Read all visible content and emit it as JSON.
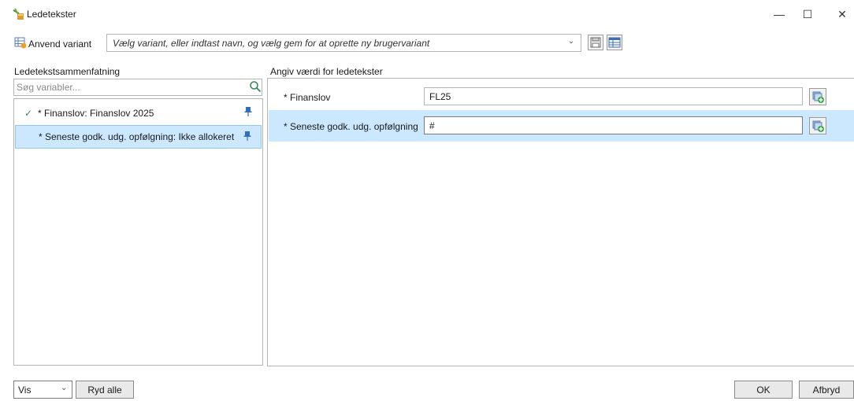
{
  "window": {
    "title": "Ledetekster",
    "icon": "ledetekster-app-icon",
    "controls": {
      "minimize": "—",
      "maximize": "☐",
      "close": "✕"
    }
  },
  "variant": {
    "label": "Anvend variant",
    "placeholder": "Vælg variant, eller indtast navn, og vælg gem for at oprette ny brugervariant",
    "caret": "⌄"
  },
  "left_panel": {
    "header": "Ledetekstsammenfatning",
    "search_placeholder": "Søg variabler...",
    "items": [
      {
        "check": "✓",
        "text": "* Finanslov: Finanslov 2025",
        "selected": false
      },
      {
        "check": "",
        "text": "* Seneste godk. udg. opfølgning: Ikke allokeret",
        "selected": true
      }
    ]
  },
  "right_panel": {
    "header": "Angiv værdi for ledetekster",
    "rows": [
      {
        "label": "* Finanslov",
        "value": "FL25"
      },
      {
        "label": "* Seneste godk. udg. opfølgning",
        "value": "#"
      }
    ]
  },
  "bottom": {
    "vis_value": "Vis",
    "vis_caret": "⌄",
    "ryd_label": "Ryd alle",
    "ok_label": "OK",
    "cancel_label": "Afbryd"
  },
  "colors": {
    "selected_bg": "#cce8ff",
    "selected_border": "#8fc8ee",
    "border": "#b5b5b5",
    "check_green": "#2e8b57",
    "pin_blue": "#2f6fc0"
  }
}
